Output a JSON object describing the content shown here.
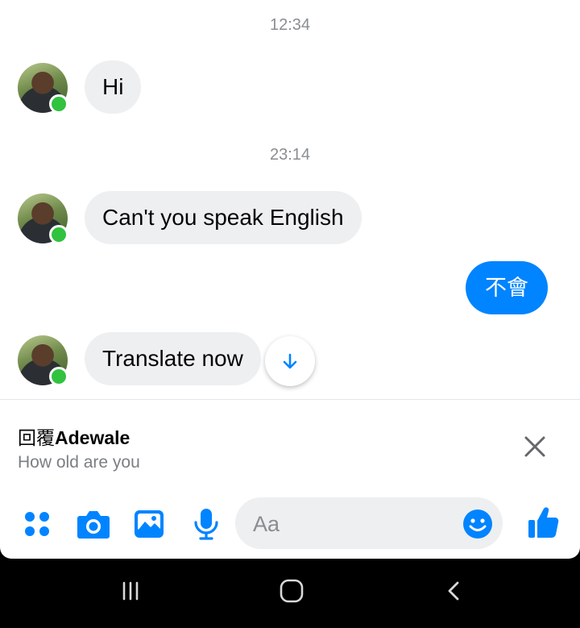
{
  "messages": {
    "timestamp_1": "12:34",
    "msg_1": "Hi",
    "timestamp_2": "23:14",
    "msg_2": "Can't you speak English",
    "msg_3_out": "不會",
    "msg_4": "Translate now"
  },
  "reply": {
    "prefix": "回覆",
    "name": "Adewale",
    "quote": "How old are you"
  },
  "composer": {
    "placeholder": "Aa"
  },
  "colors": {
    "accent": "#0084ff",
    "online": "#31c23f",
    "incoming_bubble": "#eeeff1"
  },
  "icons": [
    "apps-icon",
    "camera-icon",
    "image-icon",
    "microphone-icon",
    "emoji-icon",
    "thumbs-up-icon",
    "close-icon",
    "arrow-down-icon",
    "recents-icon",
    "home-icon",
    "back-icon"
  ]
}
